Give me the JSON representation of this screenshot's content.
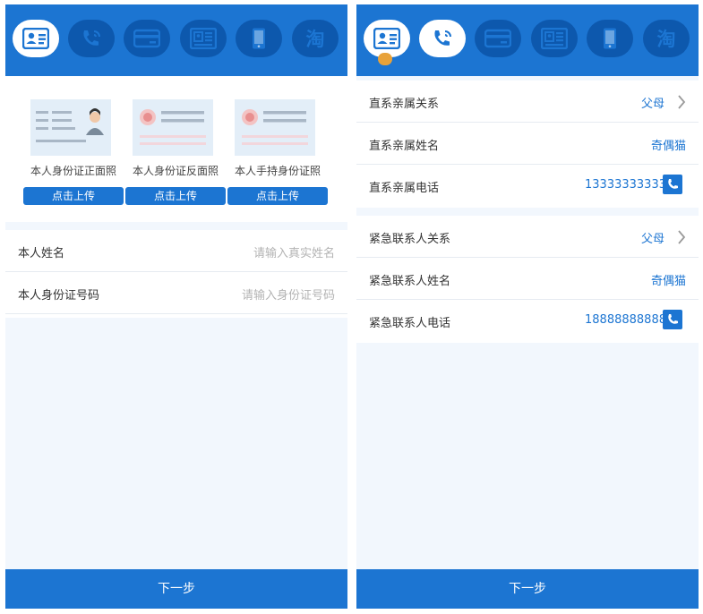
{
  "theme": {
    "primary": "#1c75d2",
    "tab_inactive": "#0d58ad",
    "panel_bg": "#f2f7fd"
  },
  "tabs": [
    {
      "icon": "id-card-icon"
    },
    {
      "icon": "phone-contacts-icon"
    },
    {
      "icon": "bank-card-icon"
    },
    {
      "icon": "social-security-icon"
    },
    {
      "icon": "mobile-phone-icon"
    },
    {
      "icon": "taobao-icon",
      "text": "淘"
    }
  ],
  "left": {
    "cards": [
      {
        "caption": "本人身份证正面照",
        "button": "点击上传"
      },
      {
        "caption": "本人身份证反面照",
        "button": "点击上传"
      },
      {
        "caption": "本人手持身份证照",
        "button": "点击上传"
      }
    ],
    "fields": [
      {
        "label": "本人姓名",
        "placeholder": "请输入真实姓名"
      },
      {
        "label": "本人身份证号码",
        "placeholder": "请输入身份证号码"
      }
    ],
    "next": "下一步"
  },
  "right": {
    "group1": [
      {
        "label": "直系亲属关系",
        "value": "父母"
      },
      {
        "label": "直系亲属姓名",
        "value": "奇偶猫"
      },
      {
        "label": "直系亲属电话",
        "value": "13333333333"
      }
    ],
    "group2": [
      {
        "label": "紧急联系人关系",
        "value": "父母"
      },
      {
        "label": "紧急联系人姓名",
        "value": "奇偶猫"
      },
      {
        "label": "紧急联系人电话",
        "value": "18888888888"
      }
    ],
    "next": "下一步"
  }
}
